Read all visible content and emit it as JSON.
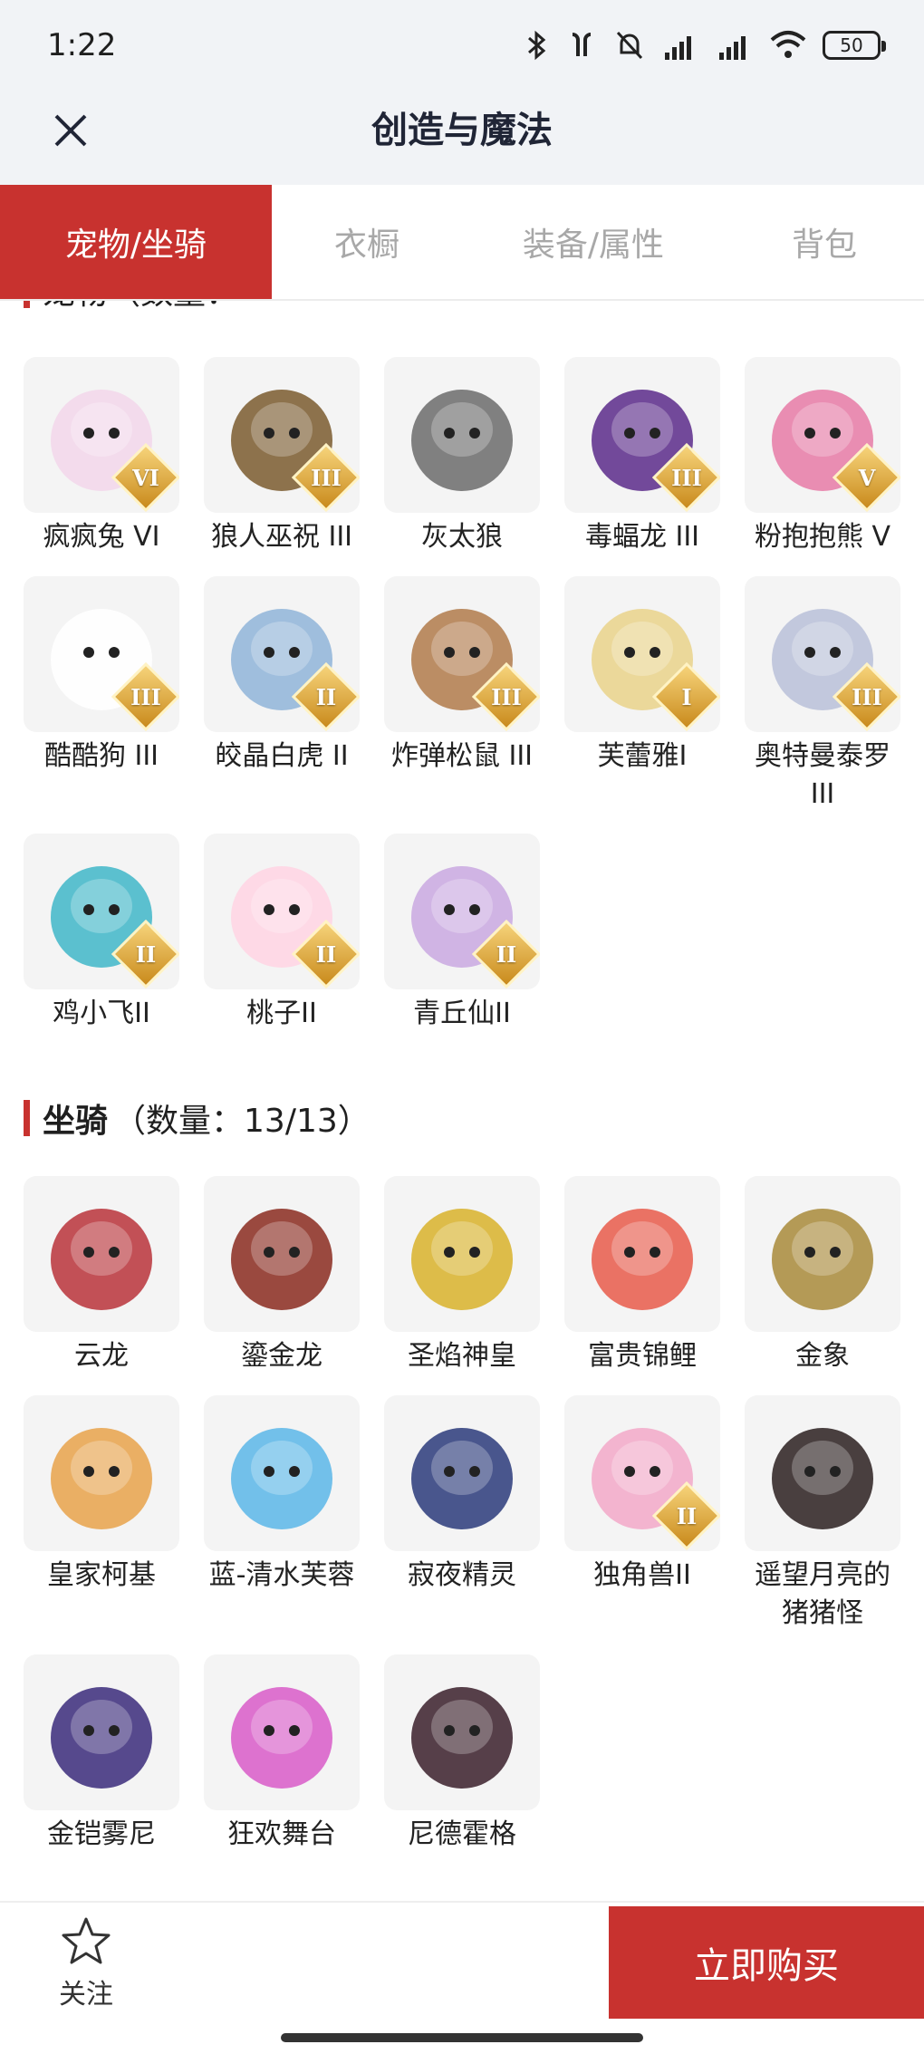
{
  "status_bar": {
    "time": "1:22",
    "battery": "50"
  },
  "header": {
    "title": "创造与魔法"
  },
  "tabs": [
    {
      "label": "宠物/坐骑",
      "active": true
    },
    {
      "label": "衣橱",
      "active": false
    },
    {
      "label": "装备/属性",
      "active": false
    },
    {
      "label": "背包",
      "active": false
    }
  ],
  "pets_section_partial": {
    "label": "宠物（数量："
  },
  "pets": [
    {
      "name": "疯疯兔 VI",
      "badge": "VI",
      "icon": "rabbit-icon",
      "color": "#f2d6ea"
    },
    {
      "name": "狼人巫祝 III",
      "badge": "III",
      "icon": "wolf-shaman-icon",
      "color": "#7a5a2e"
    },
    {
      "name": "灰太狼",
      "badge": "",
      "icon": "grey-wolf-icon",
      "color": "#6b6b6b"
    },
    {
      "name": "毒蝠龙 III",
      "badge": "III",
      "icon": "poison-dragon-icon",
      "color": "#5b2a8a"
    },
    {
      "name": "粉抱抱熊 V",
      "badge": "V",
      "icon": "pink-bear-icon",
      "color": "#e67aa6"
    },
    {
      "name": "酷酷狗 III",
      "badge": "III",
      "icon": "cool-dog-icon",
      "color": "#ffffff"
    },
    {
      "name": "皎晶白虎 II",
      "badge": "II",
      "icon": "white-tiger-icon",
      "color": "#8fb4d8"
    },
    {
      "name": "炸弹松鼠 III",
      "badge": "III",
      "icon": "squirrel-icon",
      "color": "#b07a4a"
    },
    {
      "name": "芙蕾雅I",
      "badge": "I",
      "icon": "freya-icon",
      "color": "#e9d28a"
    },
    {
      "name": "奥特曼泰罗III",
      "badge": "III",
      "icon": "ultraman-icon",
      "color": "#b8c0d8"
    },
    {
      "name": "鸡小飞II",
      "badge": "II",
      "icon": "chick-icon",
      "color": "#3fb6c8"
    },
    {
      "name": "桃子II",
      "badge": "II",
      "icon": "peach-cat-icon",
      "color": "#ffd3e3"
    },
    {
      "name": "青丘仙II",
      "badge": "II",
      "icon": "fox-fairy-icon",
      "color": "#c9a8e0"
    }
  ],
  "mounts_section": {
    "name": "坐骑",
    "count": "（数量：13/13）"
  },
  "mounts": [
    {
      "name": "云龙",
      "badge": "",
      "icon": "cloud-dragon-icon",
      "color": "#b8323a"
    },
    {
      "name": "鎏金龙",
      "badge": "",
      "icon": "gold-dragon-icon",
      "color": "#8a2a1e"
    },
    {
      "name": "圣焰神皇",
      "badge": "",
      "icon": "holy-flame-icon",
      "color": "#d8b22a"
    },
    {
      "name": "富贵锦鲤",
      "badge": "",
      "icon": "koi-icon",
      "color": "#e85a4a"
    },
    {
      "name": "金象",
      "badge": "",
      "icon": "gold-elephant-icon",
      "color": "#a88a3a"
    },
    {
      "name": "皇家柯基",
      "badge": "",
      "icon": "corgi-icon",
      "color": "#e8a24a"
    },
    {
      "name": "蓝-清水芙蓉",
      "badge": "",
      "icon": "blue-lotus-icon",
      "color": "#5ab6e8"
    },
    {
      "name": "寂夜精灵",
      "badge": "",
      "icon": "night-spirit-icon",
      "color": "#2a3a7a"
    },
    {
      "name": "独角兽II",
      "badge": "II",
      "icon": "unicorn-icon",
      "color": "#f2a8c8"
    },
    {
      "name": "遥望月亮的猪猪怪",
      "badge": "",
      "icon": "pig-icon",
      "color": "#2a1e1e"
    },
    {
      "name": "金铠雾尼",
      "badge": "",
      "icon": "armored-beast-icon",
      "color": "#3a2a7a"
    },
    {
      "name": "狂欢舞台",
      "badge": "",
      "icon": "carnival-stage-icon",
      "color": "#d85ac8"
    },
    {
      "name": "尼德霍格",
      "badge": "",
      "icon": "nidhogg-icon",
      "color": "#3a1e2a"
    }
  ],
  "bottom_bar": {
    "follow_label": "关注",
    "buy_label": "立即购买"
  },
  "colors": {
    "accent": "#c8322f",
    "header_bg": "#f1f3f6",
    "tile_bg": "#f4f4f4"
  }
}
